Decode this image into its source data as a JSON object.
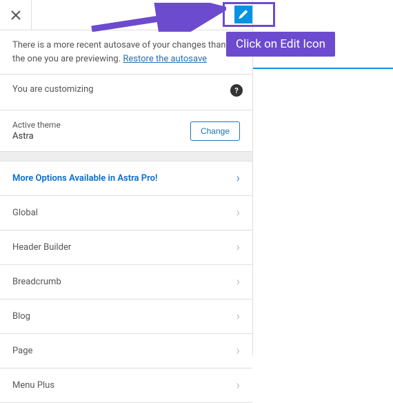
{
  "autosave": {
    "text_before": "There is a more recent autosave of your changes than the one you are previewing. ",
    "link_text": "Restore the autosave"
  },
  "customizing": {
    "label": "You are customizing"
  },
  "theme": {
    "label": "Active theme",
    "name": "Astra",
    "change_button": "Change"
  },
  "menu": {
    "promo": "More Options Available in Astra Pro!",
    "items": [
      "Global",
      "Header Builder",
      "Breadcrumb",
      "Blog",
      "Page",
      "Menu Plus"
    ]
  },
  "callout": {
    "text": "Click on Edit Icon"
  }
}
